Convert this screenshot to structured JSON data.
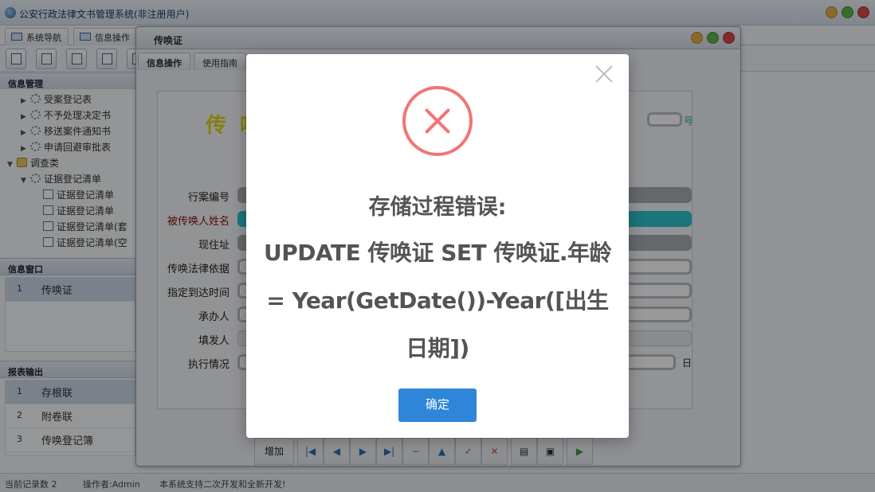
{
  "app": {
    "title": "公安行政法律文书管理系统(非注册用户)",
    "nav_tabs": [
      "系统导航",
      "信息操作"
    ]
  },
  "sidebar": {
    "info_mgmt_title": "信息管理",
    "tree": [
      {
        "label": "受案登记表"
      },
      {
        "label": "不予处理决定书"
      },
      {
        "label": "移送案件通知书"
      },
      {
        "label": "申请回避审批表"
      },
      {
        "label": "调查类"
      },
      {
        "label": "证据登记清单"
      },
      {
        "label": "证据登记清单"
      },
      {
        "label": "证据登记清单"
      },
      {
        "label": "证据登记清单(套"
      },
      {
        "label": "证据登记清单(空"
      }
    ],
    "info_window_title": "信息窗口",
    "info_window_rows": [
      {
        "num": "1",
        "label": "传唤证"
      }
    ],
    "report_title": "报表输出",
    "report_rows": [
      {
        "num": "1",
        "label": "存根联"
      },
      {
        "num": "2",
        "label": "附卷联"
      },
      {
        "num": "3",
        "label": "传唤登记簿"
      }
    ]
  },
  "child_window": {
    "title": "传唤证",
    "tabs": [
      "信息操作",
      "使用指南"
    ],
    "big_title": "传 唤",
    "num_suffix": "号",
    "fields": [
      {
        "label": "行案编号"
      },
      {
        "label": "被传唤人姓名"
      },
      {
        "label": "现住址"
      },
      {
        "label": "传唤法律依据"
      },
      {
        "label": "指定到达时间"
      },
      {
        "label": "承办人"
      },
      {
        "label": "填发人"
      },
      {
        "label": "执行情况"
      }
    ],
    "day_label": "日",
    "add_button": "增加"
  },
  "statusbar": {
    "record_count": "当前记录数 2",
    "operator": "操作者:Admin",
    "notice": "本系统支持二次开发和全新开发!"
  },
  "modal": {
    "title": "存储过程错误:",
    "message": "UPDATE 传唤证 SET 传唤证.年龄 = Year(GetDate())-Year([出生日期])",
    "ok_label": "确定"
  },
  "colors": {
    "error_red": "#f27474",
    "ok_blue": "#2f86d8",
    "title_yellow": "#e0d21c",
    "name_field_cyan": "#2ec3cc"
  }
}
